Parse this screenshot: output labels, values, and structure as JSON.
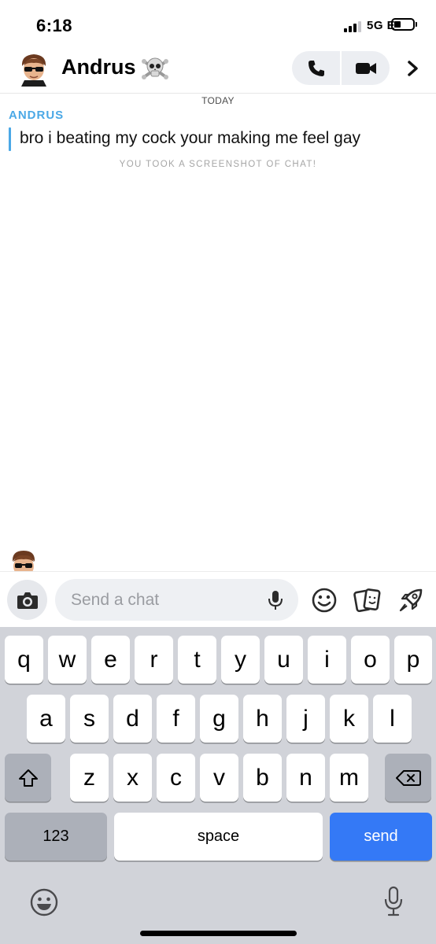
{
  "status_bar": {
    "time": "6:18",
    "network": "5G E"
  },
  "header": {
    "contact_name": "Andrus",
    "name_emoji": "☠️"
  },
  "chat": {
    "date_label": "TODAY",
    "messages": [
      {
        "sender": "ANDRUS",
        "text": "bro i beating my cock your making me feel gay"
      }
    ],
    "system_note": "YOU TOOK A SCREENSHOT OF CHAT!"
  },
  "compose": {
    "placeholder": "Send a chat"
  },
  "keyboard": {
    "row1": [
      "q",
      "w",
      "e",
      "r",
      "t",
      "y",
      "u",
      "i",
      "o",
      "p"
    ],
    "row2": [
      "a",
      "s",
      "d",
      "f",
      "g",
      "h",
      "j",
      "k",
      "l"
    ],
    "row3": [
      "z",
      "x",
      "c",
      "v",
      "b",
      "n",
      "m"
    ],
    "numbers_label": "123",
    "space_label": "space",
    "send_label": "send"
  },
  "colors": {
    "accent_blue": "#4aa8e6",
    "send_blue": "#3479f6",
    "keyboard_bg": "#d1d3d9"
  },
  "icons": [
    "phone-icon",
    "video-icon",
    "chevron-right-icon",
    "camera-icon",
    "microphone-icon",
    "smiley-icon",
    "sticker-cards-icon",
    "rocket-icon",
    "shift-icon",
    "backspace-icon",
    "emoji-keyboard-icon",
    "dictation-icon"
  ]
}
